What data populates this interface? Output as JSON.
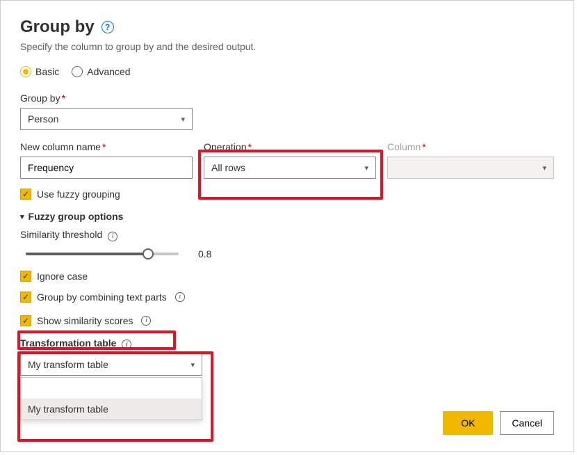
{
  "title": "Group by",
  "subtitle": "Specify the column to group by and the desired output.",
  "mode": {
    "basic": "Basic",
    "advanced": "Advanced"
  },
  "groupBy": {
    "label": "Group by",
    "value": "Person"
  },
  "newColumn": {
    "label": "New column name",
    "value": "Frequency"
  },
  "operation": {
    "label": "Operation",
    "value": "All rows"
  },
  "column": {
    "label": "Column",
    "value": ""
  },
  "fuzzy": {
    "use": "Use fuzzy grouping",
    "optionsHeader": "Fuzzy group options",
    "thresholdLabel": "Similarity threshold",
    "thresholdValue": "0.8",
    "ignoreCase": "Ignore case",
    "combineParts": "Group by combining text parts",
    "showScores": "Show similarity scores",
    "transformTableLabel": "Transformation table",
    "transformTableValue": "My transform table",
    "transformTableOption": "My transform table"
  },
  "buttons": {
    "ok": "OK",
    "cancel": "Cancel"
  }
}
